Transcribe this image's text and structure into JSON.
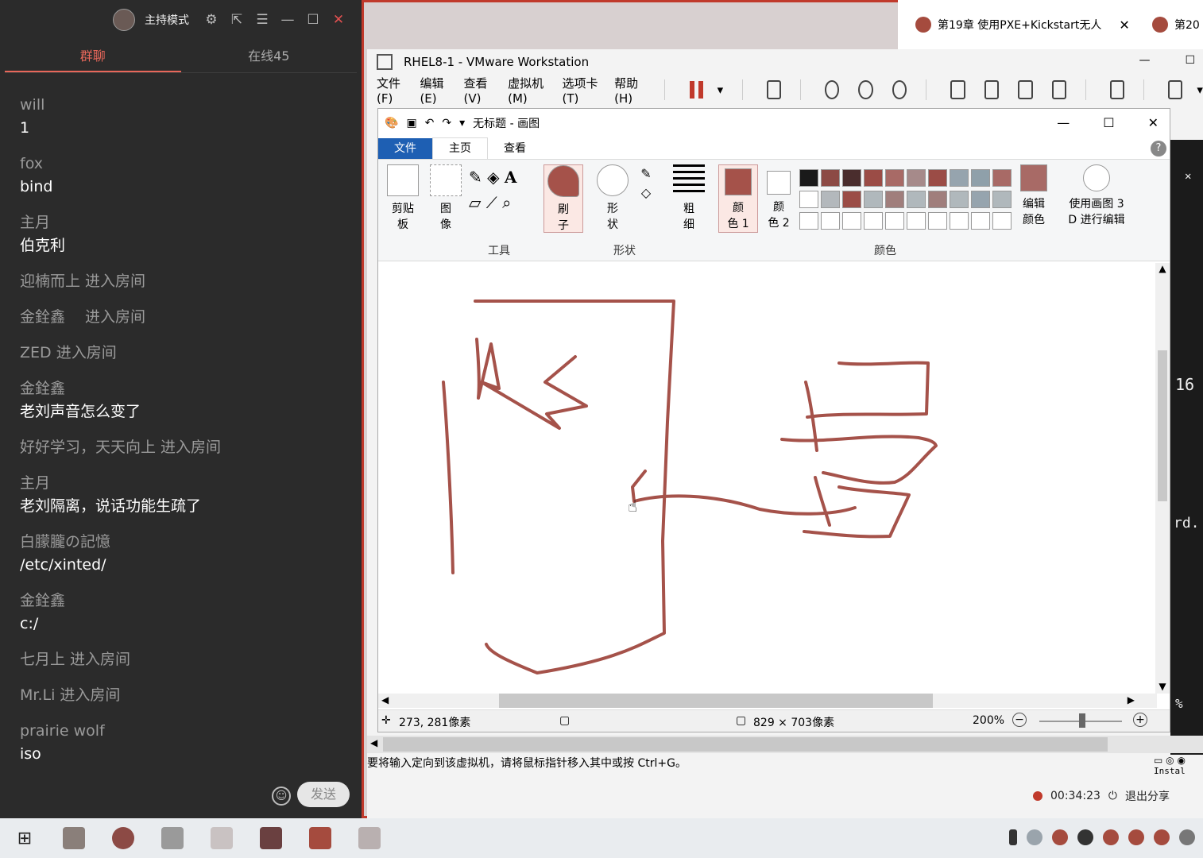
{
  "chat": {
    "host_label": "主持模式",
    "tabs": [
      "群聊",
      "在线45"
    ],
    "messages": [
      {
        "user": "will",
        "text": "1"
      },
      {
        "user": "fox",
        "text": "bind"
      },
      {
        "user": "主月",
        "text": "伯克利"
      },
      {
        "system": "迎楠而上 进入房间"
      },
      {
        "system": "金銓鑫　 进入房间"
      },
      {
        "system": "ZED 进入房间"
      },
      {
        "user": "金銓鑫",
        "text": "老刘声音怎么变了"
      },
      {
        "system": "好好学习，天天向上 进入房间"
      },
      {
        "user": "主月",
        "text": "老刘隔离，说话功能生疏了"
      },
      {
        "user": "白朦朧の記憶",
        "text": "/etc/xinted/"
      },
      {
        "user": "金銓鑫",
        "text": "c:/"
      },
      {
        "system": "七月上 进入房间"
      },
      {
        "system": "Mr.Li 进入房间"
      },
      {
        "user": "prairie wolf",
        "text": "iso"
      }
    ],
    "send_label": "发送"
  },
  "browser_tabs": [
    {
      "title": "第19章 使用PXE+Kickstart无人"
    },
    {
      "title": "第20"
    }
  ],
  "vmware": {
    "title": "RHEL8-1 - VMware Workstation",
    "menu": [
      "文件(F)",
      "编辑(E)",
      "查看(V)",
      "虚拟机(M)",
      "选项卡(T)",
      "帮助(H)"
    ],
    "status": "要将输入定向到该虚拟机，请将鼠标指针移入其中或按 Ctrl+G。",
    "recording_time": "00:34:23",
    "exit_share": "退出分享",
    "side_text": [
      "16",
      "rd.",
      "%",
      "Instal"
    ]
  },
  "paint": {
    "title": "无标题 - 画图",
    "ribbon_tabs": [
      "文件",
      "主页",
      "查看"
    ],
    "groups": {
      "clipboard": "剪贴\n板",
      "image": "图\n像",
      "tools": "工具",
      "brush": "刷\n子",
      "shapes_btn": "形\n状",
      "shapes": "形状",
      "size": "粗\n细",
      "color1": "颜\n色 1",
      "color2": "颜\n色 2",
      "colors": "颜色",
      "edit_colors": "编辑\n颜色",
      "paint3d": "使用画图 3\nD 进行编辑"
    },
    "status": {
      "cursor": "273, 281像素",
      "size": "829 × 703像素",
      "zoom": "200%"
    },
    "palette_row1": [
      "#1a1a1a",
      "#8c4a45",
      "#4a2d2d",
      "#9b4c46",
      "#a86a66",
      "#a68a8a",
      "#9b4c46",
      "#96a4ae",
      "#8fa0aa",
      "#a86a66"
    ],
    "palette_row2": [
      "#ffffff",
      "#b3b8bc",
      "#9b4c46",
      "#b0b8bc",
      "#a07e7c",
      "#b0b8bc",
      "#a07e7c",
      "#b0b8bc",
      "#96a4ae",
      "#b0b8bc"
    ],
    "brush_color": "#a5524a"
  }
}
